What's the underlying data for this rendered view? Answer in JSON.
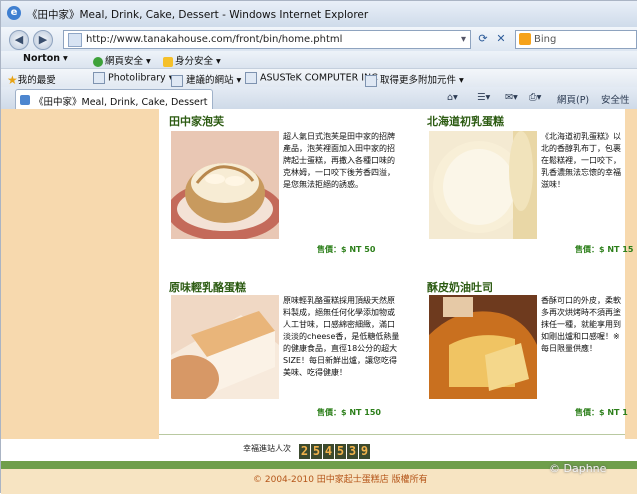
{
  "browser": {
    "window_title": "《田中家》Meal, Drink, Cake, Dessert - Windows Internet Explorer",
    "address": "http://www.tanakahouse.com/front/bin/home.phtml",
    "search_placeholder": "Bing",
    "norton": {
      "logo": "Norton",
      "web_safety": "網頁安全",
      "identity_safety": "身分安全"
    },
    "favorites": {
      "favorites_label": "我的最愛",
      "items": [
        "Photolibrary",
        "建議的網站",
        "ASUSTeK COMPUTER INC",
        "取得更多附加元件"
      ]
    },
    "tab_title": "《田中家》Meal, Drink, Cake, Dessert",
    "tab_tools": {
      "page_menu": "網頁(P)",
      "safety_menu": "安全性"
    }
  },
  "products": [
    {
      "name": "田中家泡芙",
      "description": "超人氣日式泡芙是田中家的招牌產品，泡芙裡面加入田中家的招牌起士蛋糕，再撒入各種口味的克林姆，一口咬下後芳香四溢，是您無法拒絕的誘惑。",
      "price": "售價：$ NT 50"
    },
    {
      "name": "北海道初乳蛋糕",
      "description": "《北海道初乳蛋糕》以北的香醇乳布丁，包裹在鬆糕裡，一口咬下，乳香濃無法忘懷的幸福滋味！",
      "price": "售價：$ NT 15"
    },
    {
      "name": "原味輕乳酪蛋糕",
      "description": "原味輕乳酪蛋糕採用頂級天然原料製成，絕無任何化學添加物或人工甘味，口感綿密細緻，滿口淡淡的cheese香，是低糖低熱量的健康食品，直徑18公分的超大SIZE！每日新鮮出爐，讓您吃得美味、吃得健康！",
      "price": "售價：$ NT 150"
    },
    {
      "name": "酥皮奶油吐司",
      "description": "香酥可口的外皮，柔軟多再次烘烤時不須再塗抹任一種，就能享用到如剛出爐和口感喔！※每日限量供應！",
      "price": "售價：$ NT 1"
    }
  ],
  "visit_counter": {
    "label": "幸福進站人次",
    "digits": [
      "2",
      "5",
      "4",
      "5",
      "3",
      "9"
    ]
  },
  "footer": {
    "copyright": "© 2004-2010 田中家起士蛋糕店 版權所有",
    "watermark": "© Daphne"
  },
  "colors": {
    "accent_green": "#2c5b12",
    "price_green": "#2c7f1a",
    "peach": "#f7d9ae",
    "footer_bar": "#6f9e4b",
    "footer_text": "#b5561a"
  }
}
